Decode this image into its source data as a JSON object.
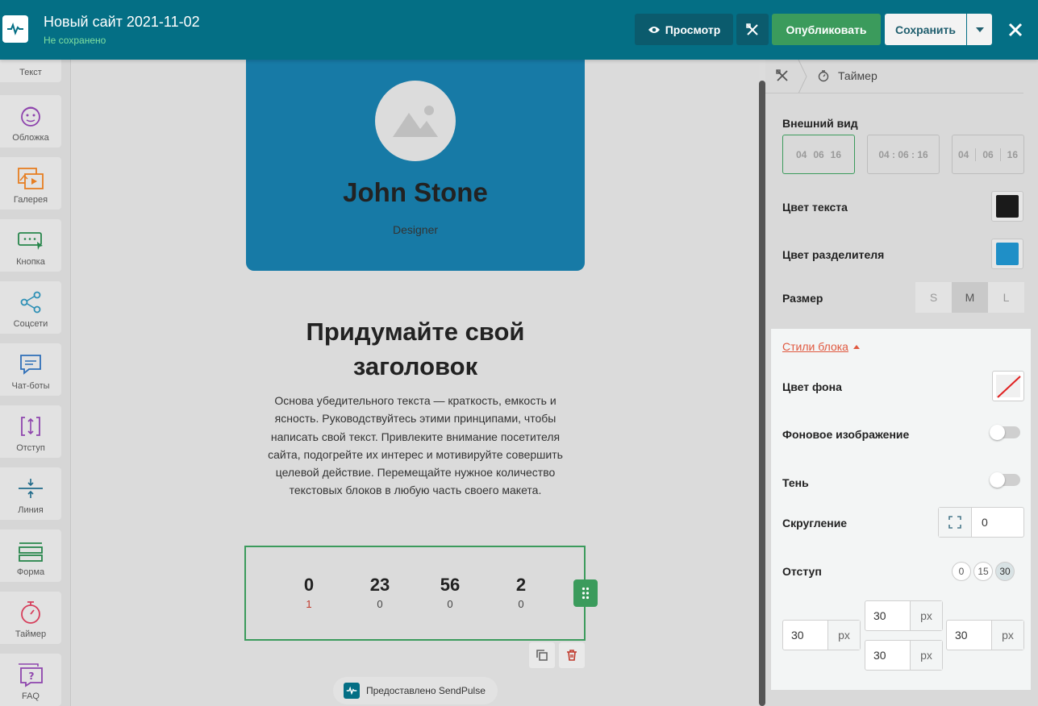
{
  "header": {
    "site_title": "Новый сайт 2021-11-02",
    "site_status": "Не сохранено",
    "preview_label": "Просмотр",
    "publish_label": "Опубликовать",
    "save_label": "Сохранить",
    "colors": {
      "bar": "#046f85",
      "publish": "#3b9b5c"
    }
  },
  "sidebar": {
    "items": [
      {
        "label": "Текст",
        "icon": "text-icon"
      },
      {
        "label": "Обложка",
        "icon": "cover-icon"
      },
      {
        "label": "Галерея",
        "icon": "gallery-icon"
      },
      {
        "label": "Кнопка",
        "icon": "button-icon"
      },
      {
        "label": "Соцсети",
        "icon": "share-icon"
      },
      {
        "label": "Чат-боты",
        "icon": "chatbot-icon"
      },
      {
        "label": "Отступ",
        "icon": "spacing-icon"
      },
      {
        "label": "Линия",
        "icon": "line-icon"
      },
      {
        "label": "Форма",
        "icon": "form-icon"
      },
      {
        "label": "Таймер",
        "icon": "timer-icon"
      },
      {
        "label": "FAQ",
        "icon": "faq-icon"
      }
    ]
  },
  "canvas": {
    "card": {
      "name": "John Stone",
      "role": "Designer",
      "color": "#177aa6"
    },
    "heading": "Придумайте свой заголовок",
    "paragraph": "Основа убедительного текста — краткость, емкость и ясность. Руководствуйтесь этими принципами, чтобы написать свой текст. Привлеките внимание посетителя сайта, подогрейте их интерес и мотивируйте совершить целевой действие. Перемещайте нужное количество текстовых блоков в любую часть своего макета.",
    "timer": [
      {
        "value": "0",
        "sub": "1"
      },
      {
        "value": "23",
        "sub": "0"
      },
      {
        "value": "56",
        "sub": "0"
      },
      {
        "value": "2",
        "sub": "0"
      }
    ],
    "powered_by": "Предоставлено SendPulse"
  },
  "panel": {
    "breadcrumb": "Таймер",
    "appearance_label": "Внешний вид",
    "appearance_options": [
      [
        "04",
        "06",
        "16"
      ],
      [
        "04 : 06 : 16"
      ],
      [
        "04",
        "06",
        "16"
      ]
    ],
    "text_color_label": "Цвет текста",
    "text_color": "#1a1a1a",
    "divider_color_label": "Цвет разделителя",
    "divider_color": "#1f8fc7",
    "size_label": "Размер",
    "sizes": [
      "S",
      "M",
      "L"
    ],
    "size_selected": "M",
    "block_styles": {
      "toggle_label": "Стили блока",
      "bg_color_label": "Цвет фона",
      "bg_image_label": "Фоновое изображение",
      "shadow_label": "Тень",
      "radius_label": "Скругление",
      "radius_value": "0",
      "padding_label": "Отступ",
      "padding_presets": [
        "0",
        "15",
        "30"
      ],
      "padding_selected": "30",
      "padding": {
        "top": "30",
        "left": "30",
        "right": "30",
        "bottom": "30",
        "unit": "px"
      }
    }
  }
}
